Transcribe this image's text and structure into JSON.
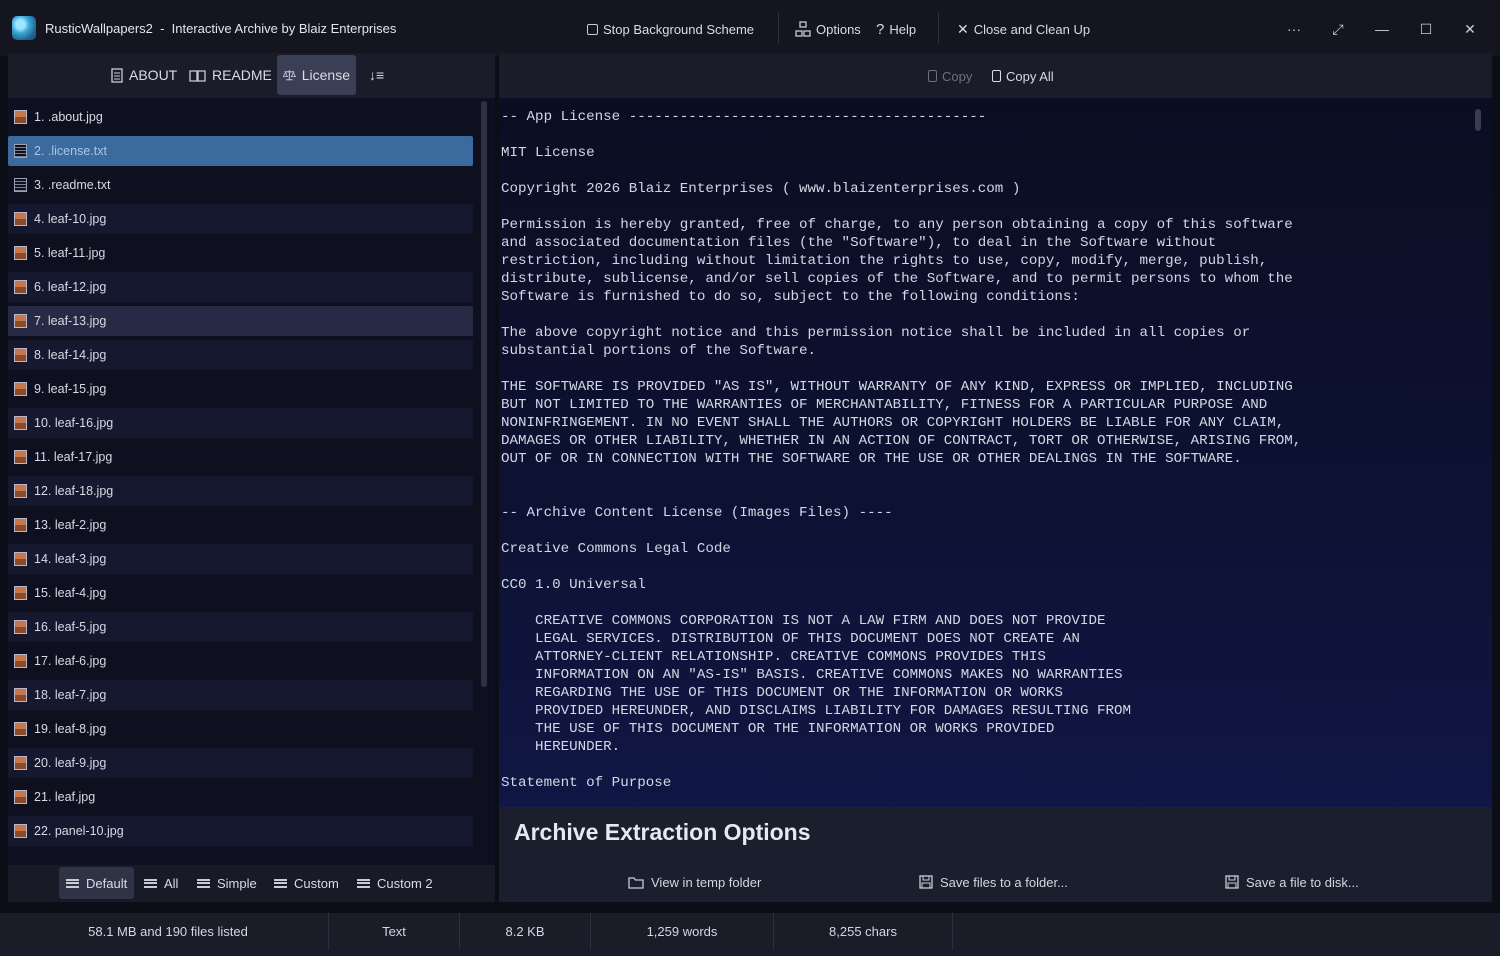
{
  "window": {
    "title": "RusticWallpapers2  -  Interactive Archive by Blaiz Enterprises",
    "stop_scheme": "Stop Background Scheme",
    "options": "Options",
    "help": "Help",
    "close_cleanup": "Close and Clean Up",
    "more": "···",
    "fullscreen": "⤢",
    "minimize": "—",
    "maximize": "☐",
    "close": "✕"
  },
  "tabs": [
    {
      "label": "ABOUT",
      "icon": "document-icon"
    },
    {
      "label": "README",
      "icon": "book-icon"
    },
    {
      "label": "License",
      "icon": "scales-icon",
      "active": true
    },
    {
      "label": "↓≡",
      "icon": "sort-icon"
    }
  ],
  "files": [
    {
      "label": "1.  .about.jpg",
      "type": "img"
    },
    {
      "label": "2.  .license.txt",
      "type": "txt",
      "selected": true
    },
    {
      "label": "3.  .readme.txt",
      "type": "txt"
    },
    {
      "label": "4.  leaf-10.jpg",
      "type": "img"
    },
    {
      "label": "5.  leaf-11.jpg",
      "type": "img"
    },
    {
      "label": "6.  leaf-12.jpg",
      "type": "img"
    },
    {
      "label": "7.  leaf-13.jpg",
      "type": "img",
      "hover": true
    },
    {
      "label": "8.  leaf-14.jpg",
      "type": "img"
    },
    {
      "label": "9.  leaf-15.jpg",
      "type": "img"
    },
    {
      "label": "10.  leaf-16.jpg",
      "type": "img"
    },
    {
      "label": "11.  leaf-17.jpg",
      "type": "img"
    },
    {
      "label": "12.  leaf-18.jpg",
      "type": "img"
    },
    {
      "label": "13.  leaf-2.jpg",
      "type": "img"
    },
    {
      "label": "14.  leaf-3.jpg",
      "type": "img"
    },
    {
      "label": "15.  leaf-4.jpg",
      "type": "img"
    },
    {
      "label": "16.  leaf-5.jpg",
      "type": "img"
    },
    {
      "label": "17.  leaf-6.jpg",
      "type": "img"
    },
    {
      "label": "18.  leaf-7.jpg",
      "type": "img"
    },
    {
      "label": "19.  leaf-8.jpg",
      "type": "img"
    },
    {
      "label": "20.  leaf-9.jpg",
      "type": "img"
    },
    {
      "label": "21.  leaf.jpg",
      "type": "img"
    },
    {
      "label": "22.  panel-10.jpg",
      "type": "img"
    }
  ],
  "bottom_tabs": [
    {
      "label": "Default",
      "active": true
    },
    {
      "label": "All"
    },
    {
      "label": "Simple"
    },
    {
      "label": "Custom"
    },
    {
      "label": "Custom 2"
    }
  ],
  "copy": {
    "copy": "Copy",
    "copy_all": "Copy All"
  },
  "document_text": "-- App License ------------------------------------------\n\nMIT License\n\nCopyright 2026 Blaiz Enterprises ( www.blaizenterprises.com )\n\nPermission is hereby granted, free of charge, to any person obtaining a copy of this software\nand associated documentation files (the \"Software\"), to deal in the Software without\nrestriction, including without limitation the rights to use, copy, modify, merge, publish,\ndistribute, sublicense, and/or sell copies of the Software, and to permit persons to whom the\nSoftware is furnished to do so, subject to the following conditions:\n\nThe above copyright notice and this permission notice shall be included in all copies or\nsubstantial portions of the Software.\n\nTHE SOFTWARE IS PROVIDED \"AS IS\", WITHOUT WARRANTY OF ANY KIND, EXPRESS OR IMPLIED, INCLUDING\nBUT NOT LIMITED TO THE WARRANTIES OF MERCHANTABILITY, FITNESS FOR A PARTICULAR PURPOSE AND\nNONINFRINGEMENT. IN NO EVENT SHALL THE AUTHORS OR COPYRIGHT HOLDERS BE LIABLE FOR ANY CLAIM,\nDAMAGES OR OTHER LIABILITY, WHETHER IN AN ACTION OF CONTRACT, TORT OR OTHERWISE, ARISING FROM,\nOUT OF OR IN CONNECTION WITH THE SOFTWARE OR THE USE OR OTHER DEALINGS IN THE SOFTWARE.\n\n\n-- Archive Content License (Images Files) ----\n\nCreative Commons Legal Code\n\nCC0 1.0 Universal\n\n    CREATIVE COMMONS CORPORATION IS NOT A LAW FIRM AND DOES NOT PROVIDE\n    LEGAL SERVICES. DISTRIBUTION OF THIS DOCUMENT DOES NOT CREATE AN\n    ATTORNEY-CLIENT RELATIONSHIP. CREATIVE COMMONS PROVIDES THIS\n    INFORMATION ON AN \"AS-IS\" BASIS. CREATIVE COMMONS MAKES NO WARRANTIES\n    REGARDING THE USE OF THIS DOCUMENT OR THE INFORMATION OR WORKS\n    PROVIDED HEREUNDER, AND DISCLAIMS LIABILITY FOR DAMAGES RESULTING FROM\n    THE USE OF THIS DOCUMENT OR THE INFORMATION OR WORKS PROVIDED\n    HEREUNDER.\n\nStatement of Purpose",
  "extraction": {
    "title": "Archive Extraction Options",
    "view_temp": "View in temp folder",
    "save_folder": "Save files to a folder...",
    "save_file": "Save a file to disk..."
  },
  "status": {
    "size": "58.1 MB and 190 files listed",
    "type": "Text",
    "file_size": "8.2 KB",
    "words": "1,259 words",
    "chars": "8,255 chars"
  }
}
